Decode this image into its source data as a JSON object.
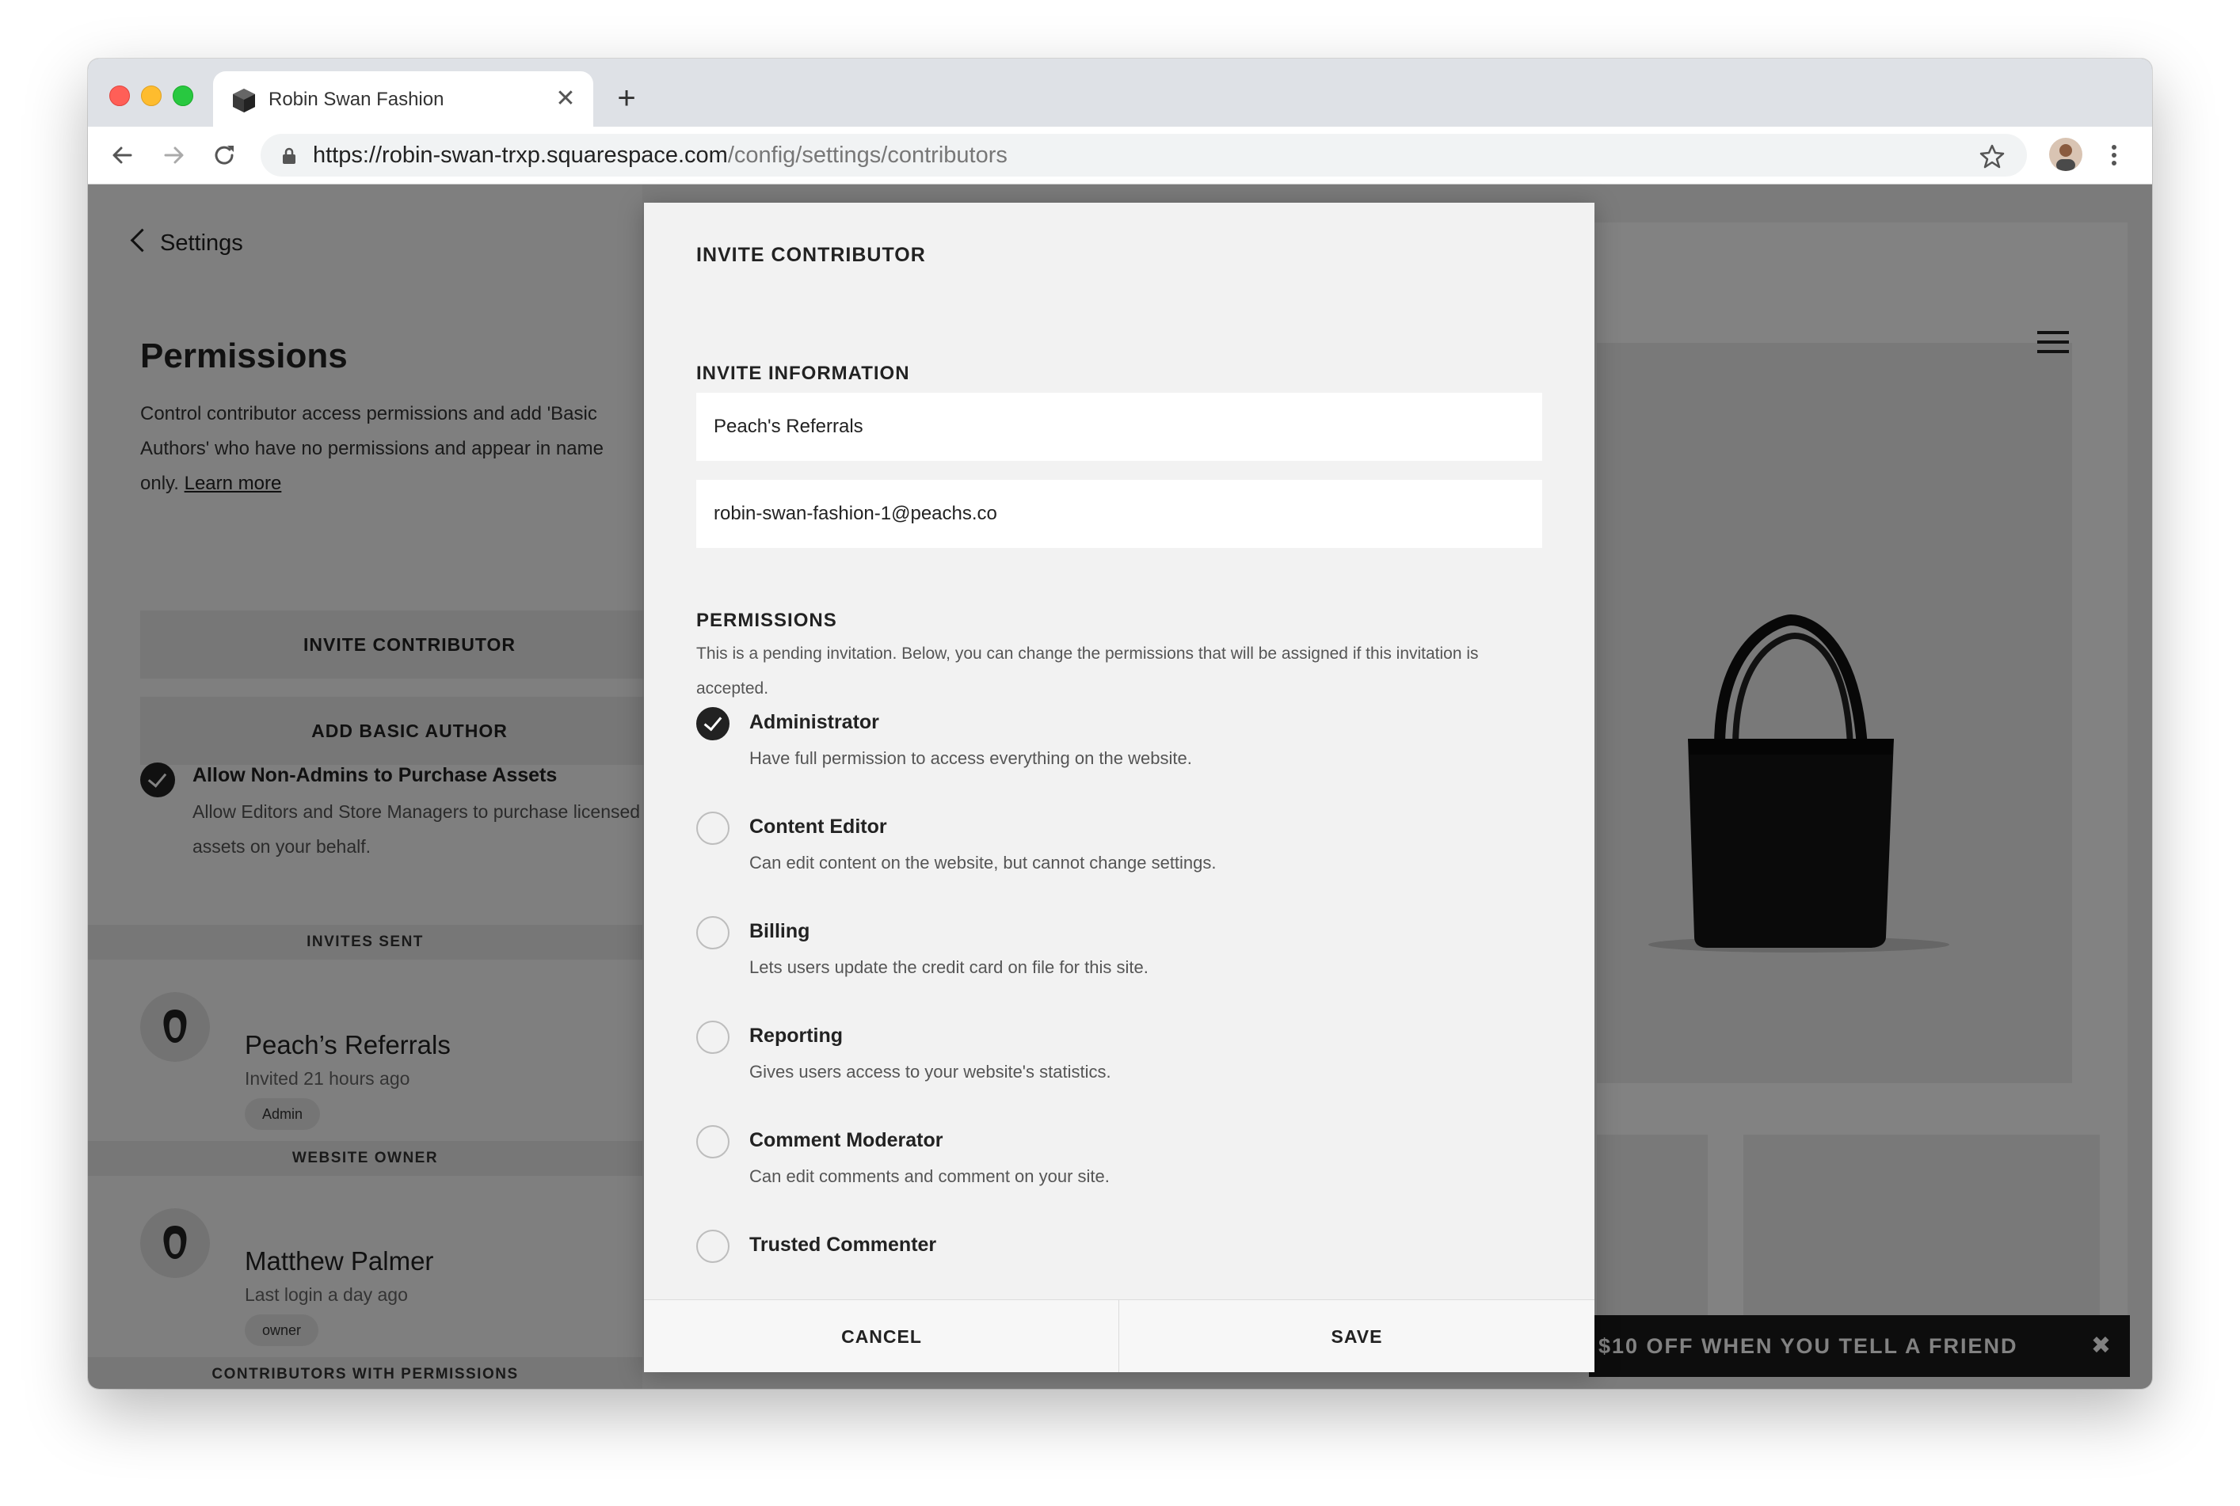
{
  "browser": {
    "tab_title": "Robin Swan Fashion",
    "tab_close": "✕",
    "new_tab": "+",
    "url_main": "https://robin-swan-trxp.squarespace.com",
    "url_path": "/config/settings/contributors"
  },
  "sidebar": {
    "back_label": "Settings",
    "title": "Permissions",
    "description": "Control contributor access permissions and add 'Basic Authors' who have no permissions and appear in name only.",
    "learn_more": "Learn more",
    "invite_button": "INVITE CONTRIBUTOR",
    "add_author_button": "ADD BASIC AUTHOR",
    "allow_title": "Allow Non-Admins to Purchase Assets",
    "allow_desc": "Allow Editors and Store Managers to purchase licensed assets on your behalf.",
    "invites_sent_header": "INVITES SENT",
    "invitee": {
      "name": "Peach’s Referrals",
      "sub": "Invited 21 hours ago",
      "badge": "Admin"
    },
    "website_owner_header": "WEBSITE OWNER",
    "owner": {
      "name": "Matthew Palmer",
      "sub": "Last login a day ago",
      "badge": "owner"
    },
    "contributors_header": "CONTRIBUTORS WITH PERMISSIONS"
  },
  "preview": {
    "promo_text": "$10 OFF WHEN YOU TELL A FRIEND",
    "promo_close": "✖"
  },
  "modal": {
    "title": "INVITE CONTRIBUTOR",
    "invite_info_label": "INVITE INFORMATION",
    "name_value": "Peach's Referrals",
    "email_value": "robin-swan-fashion-1@peachs.co",
    "permissions_label": "PERMISSIONS",
    "permissions_note": "This is a pending invitation. Below, you can change the permissions that will be assigned if this invitation is accepted.",
    "options": [
      {
        "label": "Administrator",
        "desc": "Have full permission to access everything on the website.",
        "checked": true
      },
      {
        "label": "Content Editor",
        "desc": "Can edit content on the website, but cannot change settings.",
        "checked": false
      },
      {
        "label": "Billing",
        "desc": "Lets users update the credit card on file for this site.",
        "checked": false
      },
      {
        "label": "Reporting",
        "desc": "Gives users access to your website's statistics.",
        "checked": false
      },
      {
        "label": "Comment Moderator",
        "desc": "Can edit comments and comment on your site.",
        "checked": false
      },
      {
        "label": "Trusted Commenter",
        "desc": "",
        "checked": false
      }
    ],
    "cancel_label": "CANCEL",
    "save_label": "SAVE"
  }
}
